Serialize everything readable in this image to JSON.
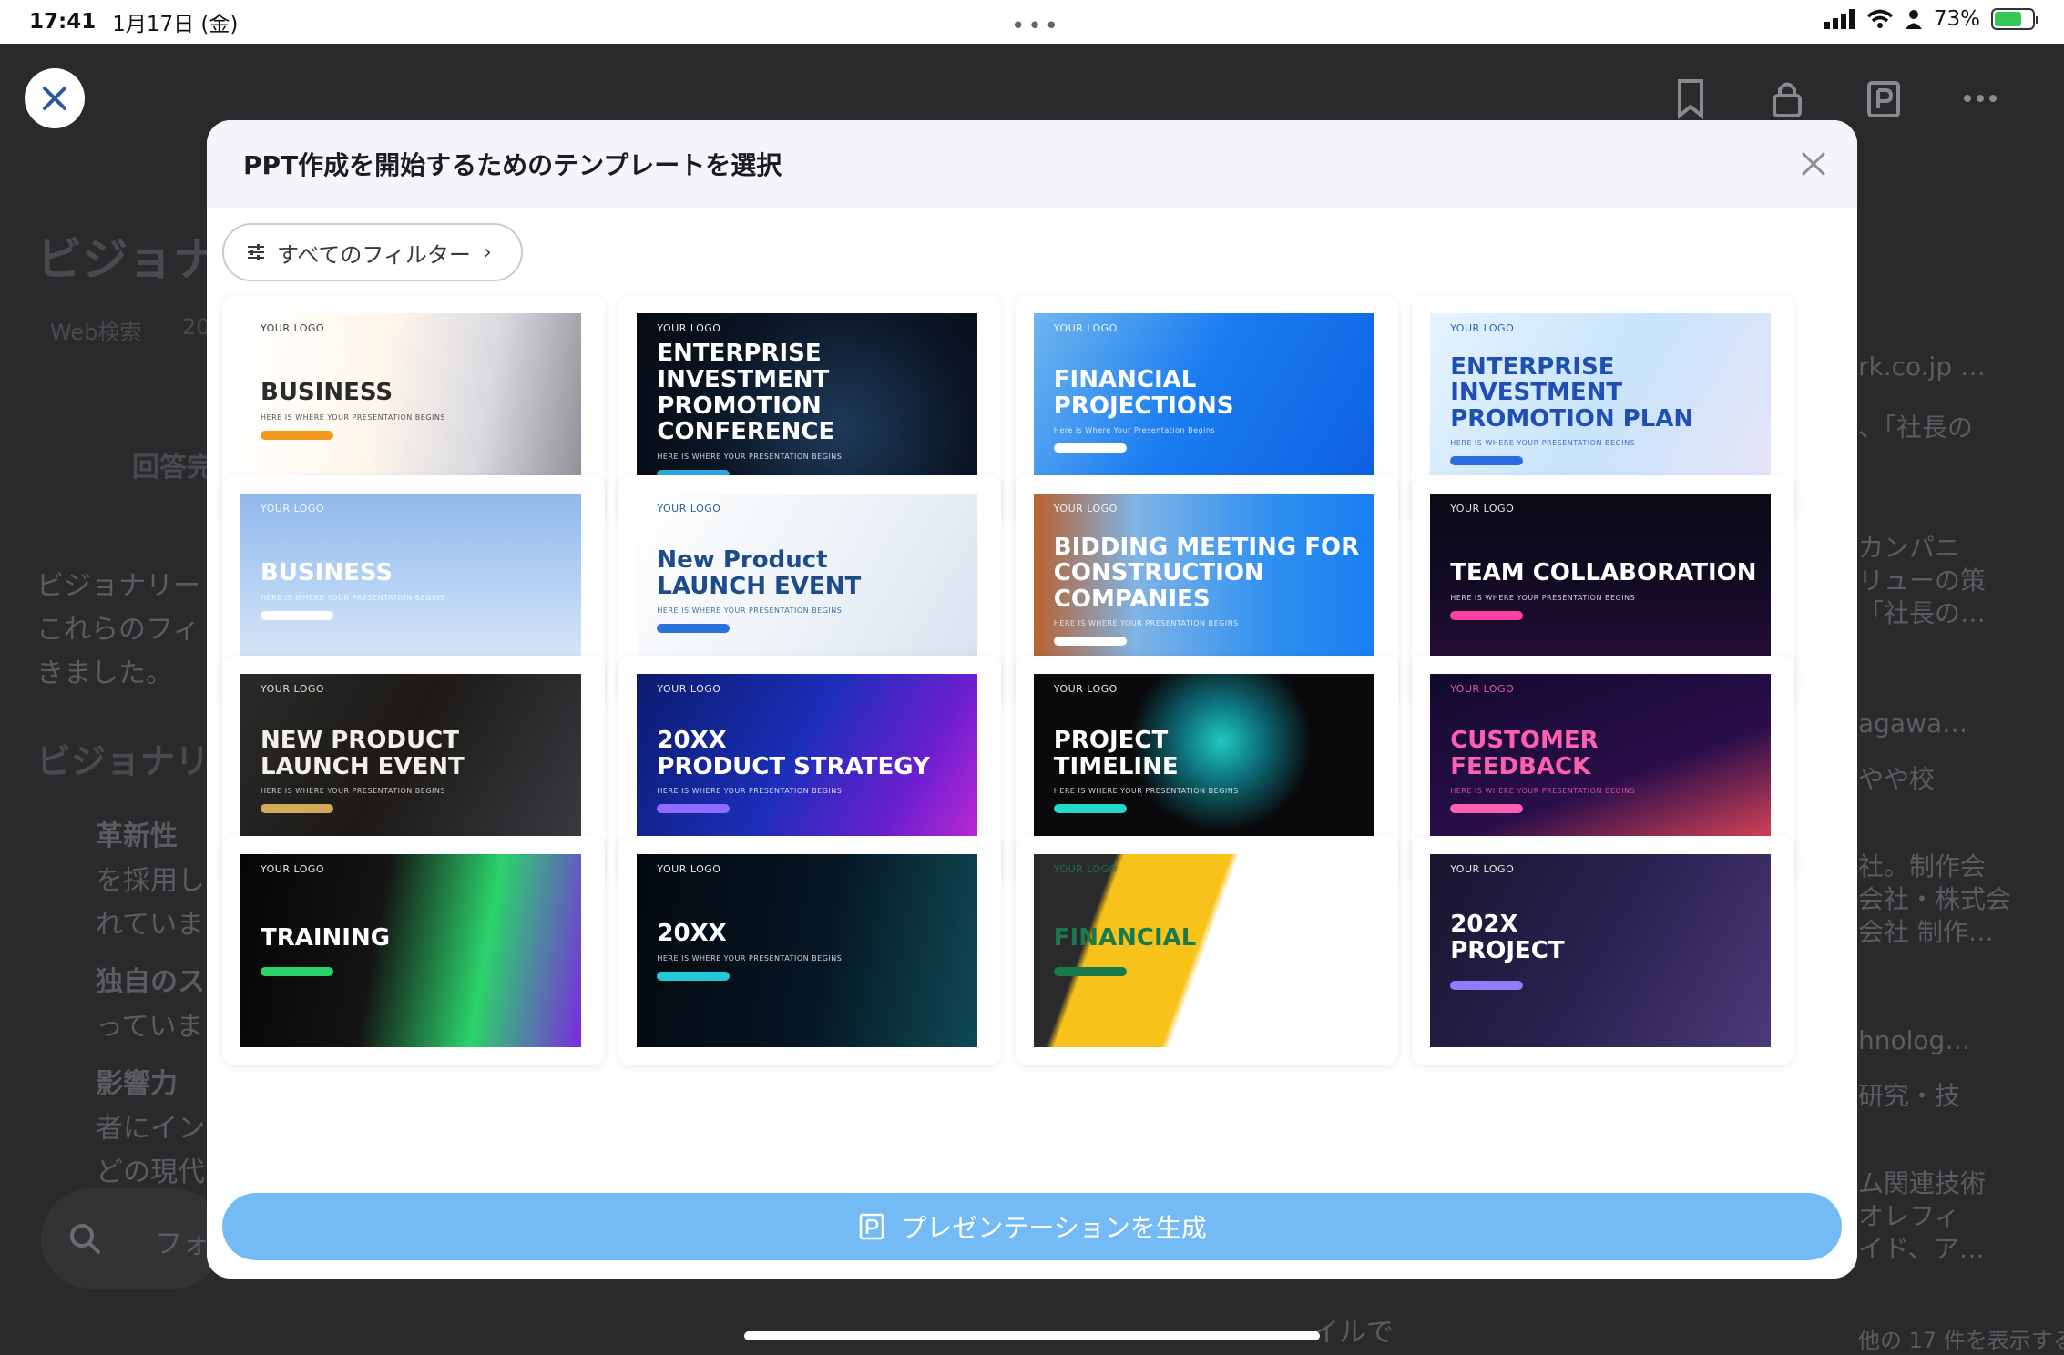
{
  "status_bar": {
    "time": "17:41",
    "date": "1月17日 (金)",
    "battery": "73%",
    "battery_level": 0.73
  },
  "background_app": {
    "title": "ビジョナ",
    "tag_1": "Web検索",
    "tag_2": "20",
    "answer_label": "回答完",
    "para_line_1": "ビジョナリー",
    "para_line_2": "これらのフィ",
    "para_line_3": "きました。",
    "section_title": "ビジョナリ",
    "bullet_1_title": "革新性",
    "bullet_1_line_2": "を採用し",
    "bullet_1_line_3": "れていま",
    "bullet_2_title": "独自のス",
    "bullet_2_line_2": "っていま",
    "bullet_3_title": "影響力",
    "bullet_3_line_2": "者にイン",
    "bullet_3_line_3": "どの現代",
    "search_placeholder": "フォ",
    "bottom_text": "イルで",
    "right_1": "rk.co.jp …",
    "right_2": "、「社長の",
    "right_3": "カンパニ",
    "right_4": "リューの策",
    "right_5": "「社長の…",
    "right_6": "agawa…",
    "right_7": "やや校",
    "right_8": "社。制作会",
    "right_9": "会社・株式会",
    "right_10": "会社 制作…",
    "right_11": "hnolog…",
    "right_12": "研究・技",
    "right_13": "ム関連技術",
    "right_14": "オレフィ",
    "right_15": "イド、ア…",
    "right_16": "他の 17 件を表示する"
  },
  "modal": {
    "title": "PPT作成を開始するためのテンプレートを選択",
    "filter_label": "すべてのフィルター",
    "generate_label": "プレゼンテーションを生成"
  },
  "templates": [
    {
      "logo": "YOUR LOGO",
      "t1": "BUSINESS",
      "t2": "",
      "sub": "HERE IS WHERE YOUR PRESENTATION BEGINS",
      "bg": "linear-gradient(100deg,#ffffff 0%,#fff7ec 40%,#d9d9df 70%,#8d8d95 100%)",
      "fg": "#2a2a2a",
      "accent": "#f39a1e"
    },
    {
      "logo": "YOUR LOGO",
      "t1": "ENTERPRISE INVESTMENT",
      "t2": "PROMOTION CONFERENCE",
      "sub": "HERE IS WHERE YOUR PRESENTATION BEGINS",
      "bg": "radial-gradient(circle at 60% 60%,#1e3a5a 0%,#0b1524 55%,#060a12 100%)",
      "fg": "#ffffff",
      "accent": "#2ea8e0"
    },
    {
      "logo": "YOUR LOGO",
      "t1": "FINANCIAL",
      "t2": "PROJECTIONS",
      "sub": "Here is Where Your Presentation Begins",
      "bg": "linear-gradient(120deg,#6fb6ef 0%,#1a7cf0 45%,#0d5fe0 100%)",
      "fg": "#ffffff",
      "accent": "#ffffff"
    },
    {
      "logo": "YOUR LOGO",
      "t1": "ENTERPRISE INVESTMENT",
      "t2": "PROMOTION PLAN",
      "sub": "HERE IS WHERE YOUR PRESENTATION BEGINS",
      "bg": "linear-gradient(120deg,#e6f3ff 0%,#c8e4fb 50%,#e9e4f7 100%)",
      "fg": "#1f4fb5",
      "accent": "#2b6de0"
    },
    {
      "logo": "YOUR LOGO",
      "t1": "BUSINESS",
      "t2": "",
      "sub": "HERE IS WHERE YOUR PRESENTATION BEGINS",
      "bg": "linear-gradient(180deg,#8fb8ea 0%,#bcd6f5 55%,#e6ecf5 100%)",
      "fg": "#ffffff",
      "accent": "#ffffff"
    },
    {
      "logo": "YOUR LOGO",
      "t1": "New Product",
      "t2": "LAUNCH EVENT",
      "sub": "HERE IS WHERE YOUR PRESENTATION BEGINS",
      "bg": "linear-gradient(120deg,#ffffff 0%,#eef3f8 50%,#d7e2ee 100%)",
      "fg": "#1d4b8c",
      "accent": "#2a73d8"
    },
    {
      "logo": "YOUR LOGO",
      "t1": "BIDDING MEETING FOR",
      "t2": "CONSTRUCTION COMPANIES",
      "sub": "HERE IS WHERE YOUR PRESENTATION BEGINS",
      "bg": "linear-gradient(90deg,#b8612f 0%,#7fb4e6 30%,#2f8ff0 70%,#1a7ef0 100%)",
      "fg": "#ffffff",
      "accent": "#ffffff"
    },
    {
      "logo": "YOUR LOGO",
      "t1": "TEAM COLLABORATION",
      "t2": "",
      "sub": "HERE IS WHERE YOUR PRESENTATION BEGINS",
      "bg": "linear-gradient(180deg,#0a0a12 0%,#130b26 50%,#2a0e3c 100%)",
      "fg": "#ffffff",
      "accent": "#ff3fa4"
    },
    {
      "logo": "YOUR LOGO",
      "t1": "NEW PRODUCT",
      "t2": "LAUNCH EVENT",
      "sub": "HERE IS WHERE YOUR PRESENTATION BEGINS",
      "bg": "linear-gradient(120deg,#2a2a2a 0%,#1d1a17 45%,#3a3d44 100%)",
      "fg": "#f3f0e8",
      "accent": "#d5a95a"
    },
    {
      "logo": "YOUR LOGO",
      "t1": "20XX",
      "t2": "PRODUCT STRATEGY",
      "sub": "HERE IS WHERE YOUR PRESENTATION BEGINS",
      "bg": "linear-gradient(120deg,#0b1a6e 0%,#1b2fb8 45%,#6b1fd0 75%,#c92ad4 100%)",
      "fg": "#ffffff",
      "accent": "#8f6cff"
    },
    {
      "logo": "YOUR LOGO",
      "t1": "PROJECT",
      "t2": "TIMELINE",
      "sub": "HERE IS WHERE YOUR PRESENTATION BEGINS",
      "bg": "radial-gradient(circle at 55% 35%,#1fc9c0 0%,#0d6f7a 18%,#0a0a0c 40%,#0a0a0c 100%)",
      "fg": "#ffffff",
      "accent": "#25d7c8"
    },
    {
      "logo": "YOUR LOGO",
      "t1": "CUSTOMER",
      "t2": "FEEDBACK",
      "sub": "HERE IS WHERE YOUR PRESENTATION BEGINS",
      "bg": "linear-gradient(160deg,#120a2e 0%,#2a0e4a 55%,#ff4f5a 100%)",
      "fg": "#ff5fb0",
      "accent": "#ff5fb0"
    },
    {
      "logo": "YOUR LOGO",
      "t1": "TRAINING",
      "t2": "",
      "sub": "",
      "bg": "linear-gradient(100deg,#050505 0%,#141414 40%,#2bd36b 70%,#7a2be0 100%)",
      "fg": "#ffffff",
      "accent": "#2bd36b"
    },
    {
      "logo": "YOUR LOGO",
      "t1": "20XX",
      "t2": "",
      "sub": "HERE IS WHERE YOUR PRESENTATION BEGINS",
      "bg": "linear-gradient(100deg,#03080f 0%,#061725 55%,#0f4a55 100%)",
      "fg": "#ffffff",
      "accent": "#22c9d6"
    },
    {
      "logo": "YOUR LOGO",
      "t1": "FINANCIAL",
      "t2": "",
      "sub": "",
      "bg": "linear-gradient(110deg,#2a2a2a 0%,#2a2a2a 20%,#f7c21a 22%,#f7c21a 48%,#ffffff 50%,#ffffff 100%)",
      "fg": "#1a7a4c",
      "accent": "#1a7a4c"
    },
    {
      "logo": "YOUR LOGO",
      "t1": "202X",
      "t2": "PROJECT",
      "sub": "",
      "bg": "linear-gradient(120deg,#1a1530 0%,#2a2150 50%,#4a3a78 100%)",
      "fg": "#ffffff",
      "accent": "#8f7cff"
    }
  ]
}
